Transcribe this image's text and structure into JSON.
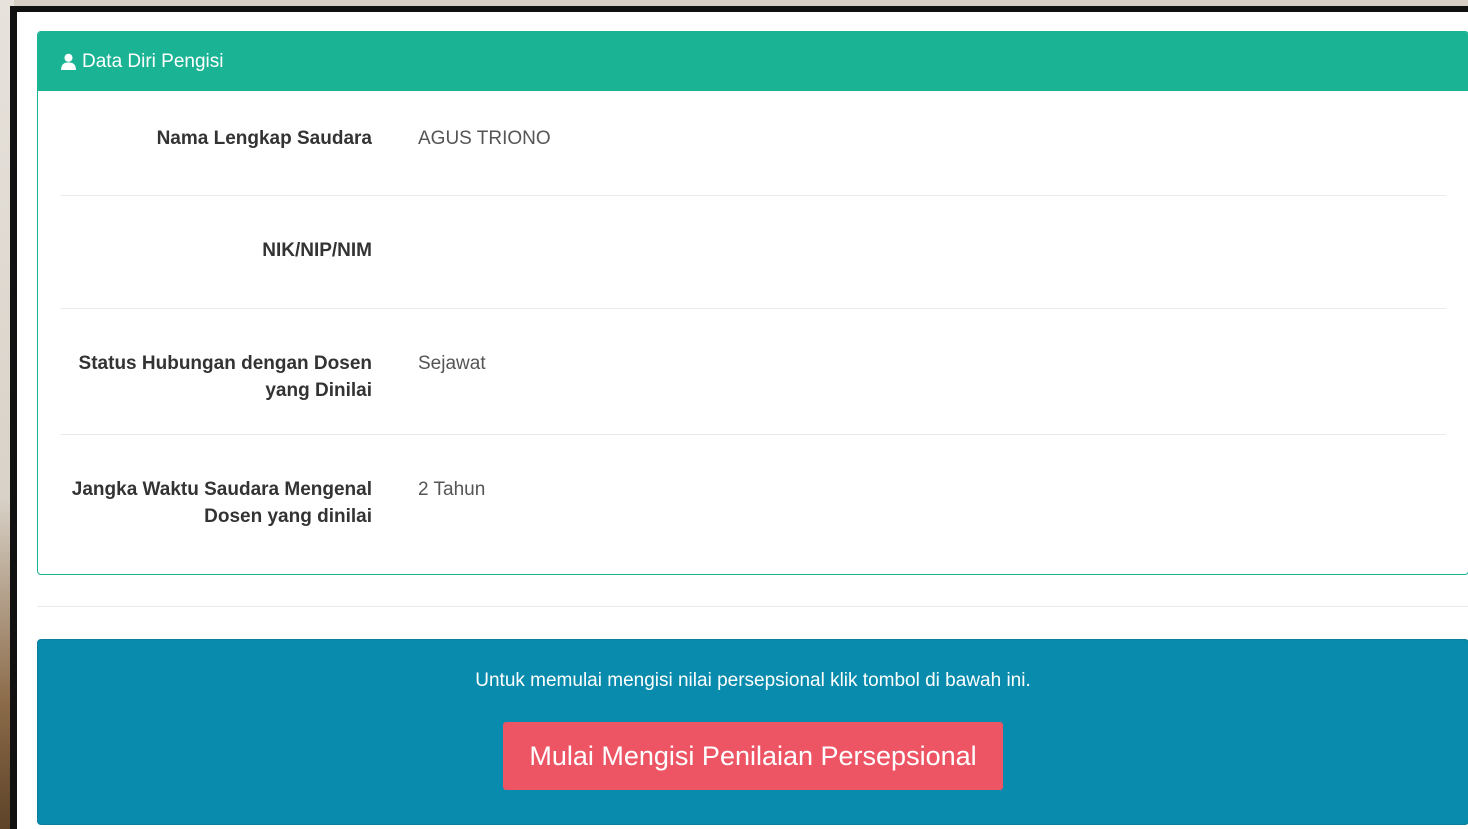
{
  "panel": {
    "icon": "user-icon",
    "title": "Data Diri Pengisi",
    "fields": [
      {
        "label": "Nama Lengkap Saudara",
        "value": "AGUS TRIONO"
      },
      {
        "label": "NIK/NIP/NIM",
        "value": ""
      },
      {
        "label_line1": "Status Hubungan dengan Dosen",
        "label_line2": "yang Dinilai",
        "value": "Sejawat"
      },
      {
        "label_line1": "Jangka Waktu Saudara Mengenal",
        "label_line2": "Dosen yang dinilai",
        "value": "2 Tahun"
      }
    ]
  },
  "info": {
    "text": "Untuk memulai mengisi nilai persepsional klik tombol di bawah ini.",
    "button_label": "Mulai Mengisi Penilaian Persepsional"
  },
  "colors": {
    "panel_header": "#1ab394",
    "info_background": "#088bad",
    "button": "#ed5565"
  }
}
